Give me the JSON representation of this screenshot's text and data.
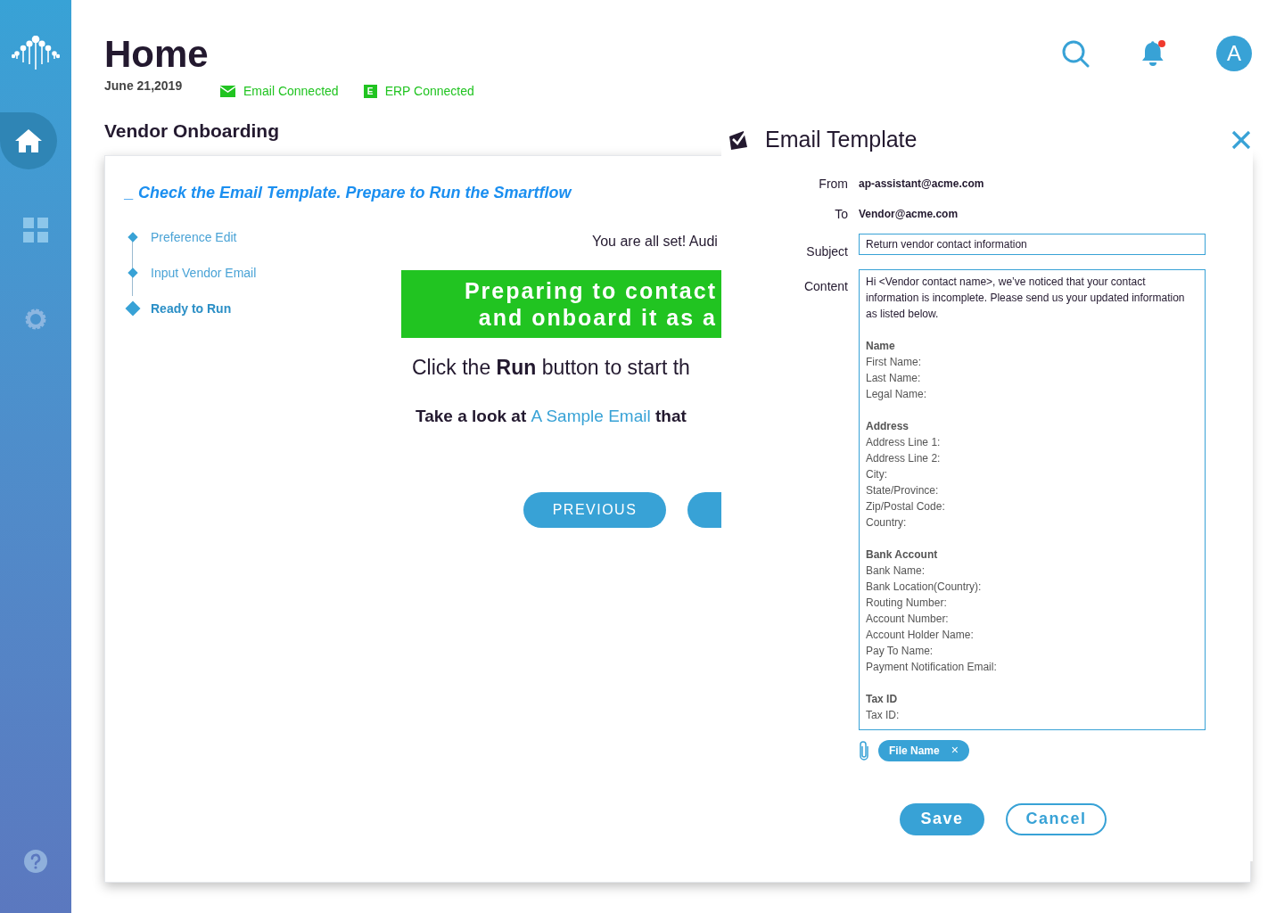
{
  "sidebar": {
    "items": [
      {
        "kind": "home",
        "selected": true
      },
      {
        "kind": "apps",
        "selected": false
      },
      {
        "kind": "settings",
        "selected": false
      }
    ]
  },
  "header": {
    "title": "Home",
    "date": "June 21,2019",
    "connections": [
      {
        "kind": "email",
        "label": "Email Connected"
      },
      {
        "kind": "erp",
        "label": "ERP Connected",
        "icon_text": "E"
      }
    ],
    "avatar": "A",
    "notification": true
  },
  "section_title": "Vendor Onboarding",
  "card": {
    "heading": "_ Check the Email Template. Prepare to Run the Smartflow",
    "steps": [
      {
        "label": "Preference Edit",
        "selected": false
      },
      {
        "label": "Input Vendor Email",
        "selected": false
      },
      {
        "label": "Ready to Run",
        "selected": true
      }
    ],
    "status_text": "You are all set! Audi",
    "banner_lines": [
      "Preparing to contact",
      "and onboard it as a"
    ],
    "instruction": "Click the **Run** button to start th",
    "sample_prefix": "Take a look at",
    "sample_link": "A Sample Email",
    "sample_suffix": "that",
    "previous_button": "PREVIOUS"
  },
  "email_template": {
    "title": "Email Template",
    "from_label": "From",
    "from": "ap-assistant@acme.com",
    "to_label": "To",
    "to": "Vendor@acme.com",
    "subject_label": "Subject",
    "subject": "Return vendor contact information",
    "content_label": "Content",
    "intro": "Hi <Vendor contact name>, we’ve noticed that your contact information is incomplete. Please send us your updated information as listed below.",
    "sections": [
      {
        "heading": "Name",
        "fields": [
          "First Name:",
          "Last Name:",
          "Legal Name:"
        ]
      },
      {
        "heading": "Address",
        "fields": [
          "Address Line 1:",
          "Address Line 2:",
          "City:",
          "State/Province:",
          "Zip/Postal Code:",
          "Country:"
        ]
      },
      {
        "heading": "Bank Account",
        "fields": [
          "Bank Name:",
          "Bank Location(Country):",
          "Routing Number:",
          "Account Number:",
          "Account Holder Name:",
          "Pay To Name:",
          "Payment Notification Email:"
        ]
      },
      {
        "heading": "Tax ID",
        "fields": [
          "Tax ID:"
        ]
      }
    ],
    "attachments": [
      {
        "name": "File Name",
        "remove": "×"
      }
    ],
    "buttons": [
      {
        "label": "Save",
        "kind": "primary"
      },
      {
        "label": "Cancel",
        "kind": "secondary"
      }
    ]
  }
}
